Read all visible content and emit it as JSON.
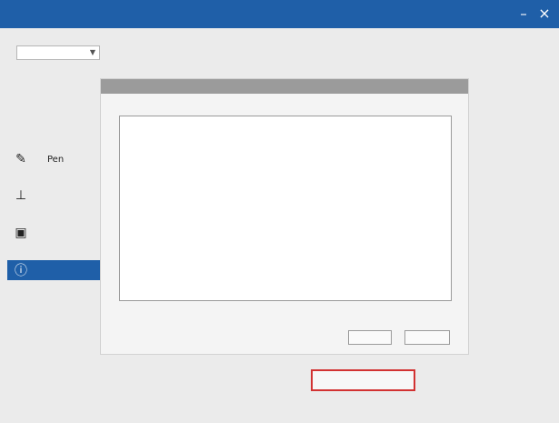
{
  "window": {
    "title": "",
    "min_glyph": "–",
    "close_glyph": "×"
  },
  "device": {
    "label": "",
    "selected": ""
  },
  "nav": {
    "items": [
      {
        "label": "Pen",
        "icon": "pen-icon",
        "glyph": "✎"
      },
      {
        "label": "",
        "icon": "mapping-icon",
        "glyph": "⊥"
      },
      {
        "label": "",
        "icon": "monitor-icon",
        "glyph": "▣"
      },
      {
        "label": "",
        "icon": "info-icon",
        "glyph": "ⓘ"
      }
    ],
    "selected_index": 3
  },
  "dialog": {
    "title": "",
    "section_label": "",
    "log_lines": [
      {
        "text": "",
        "level": "warn"
      },
      {
        "text": "",
        "level": "warn"
      },
      {
        "text": "",
        "level": "info"
      },
      {
        "text": "",
        "level": "info"
      }
    ],
    "disabled_button": "",
    "primary_button": ""
  },
  "footer": {
    "diagnostics_link": ""
  },
  "colors": {
    "accent": "#1f5fa8",
    "highlight_border": "#d23232"
  }
}
